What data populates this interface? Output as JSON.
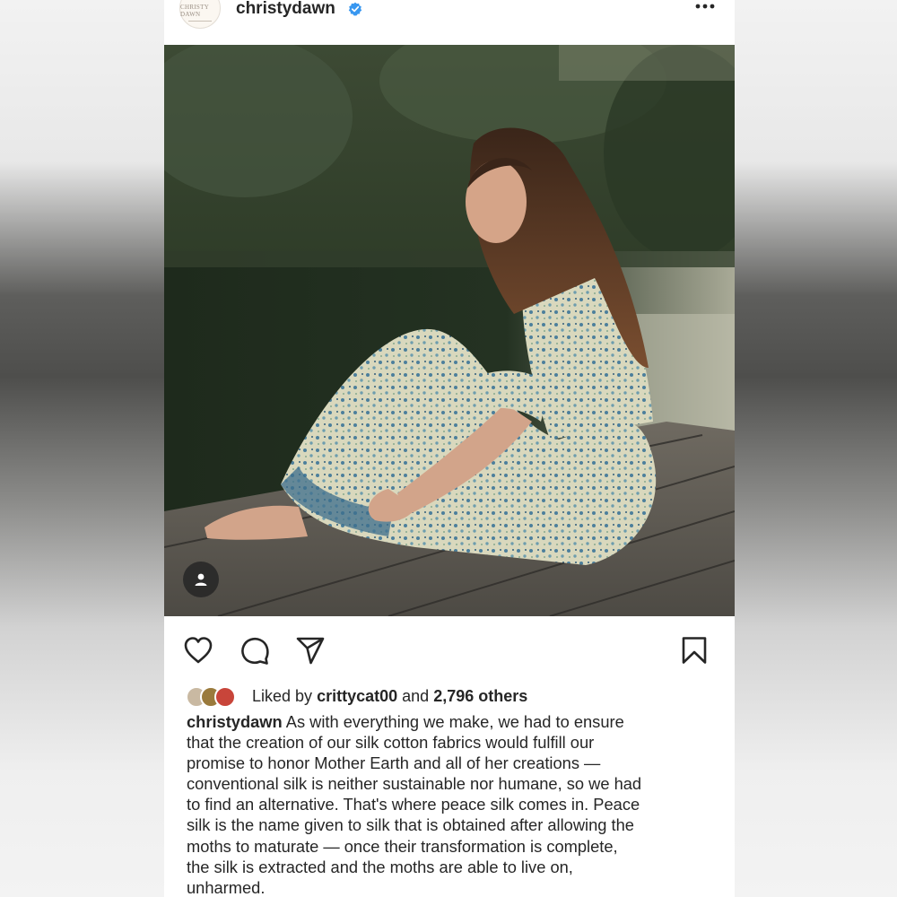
{
  "post": {
    "username": "christydawn",
    "avatar_logo_text": "CHRISTY DAWN",
    "verified_icon": "verified-badge-icon",
    "more_icon": "more-options-icon",
    "image_alt": "Woman in a blue floral dress sitting barefoot on a wooden dock by a pond",
    "tag_icon": "user-tag-icon"
  },
  "actions": {
    "like_icon": "heart-icon",
    "comment_icon": "comment-icon",
    "share_icon": "send-icon",
    "save_icon": "bookmark-icon"
  },
  "likes": {
    "prefix": "Liked by",
    "user": "crittycat00",
    "middle": "and",
    "others": "2,796 others"
  },
  "caption": {
    "author": "christydawn",
    "lines": [
      "As with everything we make, we had to ensure",
      "that the creation of our silk cotton fabrics would fulfill our",
      "promise to honor Mother Earth and all of her creations —",
      "conventional silk is neither sustainable nor humane, so we had",
      "to find an alternative. That's where peace silk comes in. Peace",
      "silk is the name given to silk that is obtained after allowing the",
      "moths to maturate — once their transformation is complete,",
      "the silk is extracted and the moths are able to live on,",
      "unharmed."
    ]
  }
}
